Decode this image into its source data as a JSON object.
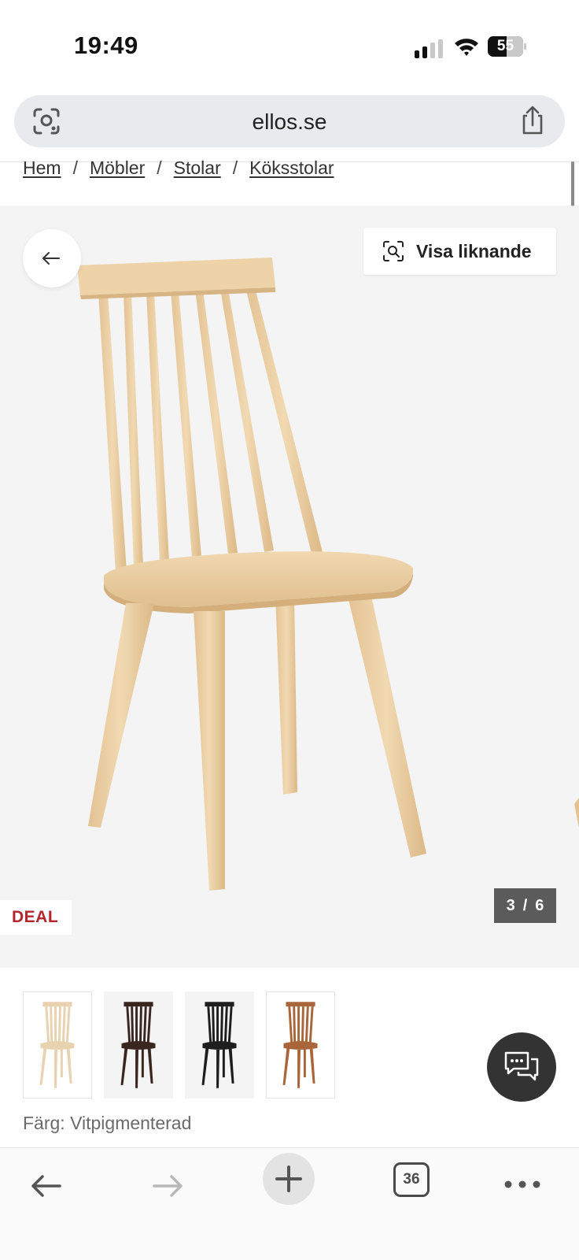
{
  "status_bar": {
    "time": "19:49",
    "battery": "55"
  },
  "browser": {
    "url": "ellos.se",
    "tab_count": "36"
  },
  "breadcrumb": {
    "items": [
      "Hem",
      "Möbler",
      "Stolar",
      "Köksstolar"
    ],
    "separator": "/"
  },
  "gallery": {
    "similar_label": "Visa liknande",
    "deal_label": "DEAL",
    "counter_current": "3",
    "counter_sep": "/",
    "counter_total": "6"
  },
  "thumbnails": [
    {
      "color": "#e8d2b0",
      "selected": true
    },
    {
      "color": "#3a2520",
      "selected": false
    },
    {
      "color": "#1e1e1e",
      "selected": false
    },
    {
      "color": "#a8663a",
      "selected": false
    }
  ],
  "color_info": {
    "text": "Färg: Vitpigmenterad"
  },
  "colors": {
    "deal": "#b3262d",
    "chair_wood": "#ebcfa4",
    "chat_button": "#333333"
  },
  "icons": {
    "lens": "lens-icon",
    "share": "share-icon",
    "back": "arrow-left-icon",
    "similar": "visual-search-icon",
    "chat": "chat-bubbles-icon",
    "toolbar_back": "arrow-left-icon",
    "toolbar_forward": "arrow-right-icon",
    "new_tab": "plus-icon",
    "more": "more-dots-icon"
  }
}
